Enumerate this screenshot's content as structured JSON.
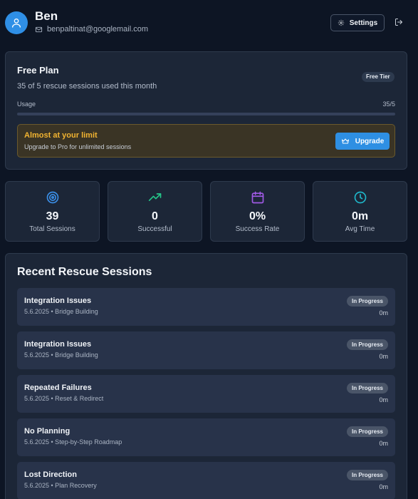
{
  "user": {
    "name": "Ben",
    "email": "benpaltinat@googlemail.com",
    "avatar_icon": "user-icon"
  },
  "header": {
    "settings_label": "Settings",
    "settings_icon": "gear-icon",
    "logout_icon": "logout-icon"
  },
  "plan": {
    "title": "Free Plan",
    "subtitle": "35 of 5 rescue sessions used this month",
    "badge": "Free Tier",
    "usage_label": "Usage",
    "usage_value": "35/5",
    "usage_fraction": 0,
    "warning": {
      "title": "Almost at your limit",
      "subtitle": "Upgrade to Pro for unlimited sessions",
      "button_label": "Upgrade",
      "button_icon": "crown-icon"
    }
  },
  "stats": [
    {
      "value": "39",
      "label": "Total Sessions",
      "icon": "target-icon",
      "color": "#3b8fe8"
    },
    {
      "value": "0",
      "label": "Successful",
      "icon": "trending-up-icon",
      "color": "#25c78a"
    },
    {
      "value": "0%",
      "label": "Success Rate",
      "icon": "calendar-icon",
      "color": "#a05ae6"
    },
    {
      "value": "0m",
      "label": "Avg Time",
      "icon": "clock-icon",
      "color": "#1fb6c9"
    }
  ],
  "sessions": {
    "title": "Recent Rescue Sessions",
    "items": [
      {
        "title": "Integration Issues",
        "meta": "5.6.2025 • Bridge Building",
        "status": "In Progress",
        "time": "0m"
      },
      {
        "title": "Integration Issues",
        "meta": "5.6.2025 • Bridge Building",
        "status": "In Progress",
        "time": "0m"
      },
      {
        "title": "Repeated Failures",
        "meta": "5.6.2025 • Reset & Redirect",
        "status": "In Progress",
        "time": "0m"
      },
      {
        "title": "No Planning",
        "meta": "5.6.2025 • Step-by-Step Roadmap",
        "status": "In Progress",
        "time": "0m"
      },
      {
        "title": "Lost Direction",
        "meta": "5.6.2025 • Plan Recovery",
        "status": "In Progress",
        "time": "0m"
      }
    ]
  },
  "colors": {
    "accent": "#2e8fe3",
    "warning": "#f2b431",
    "background": "#0d1524"
  }
}
